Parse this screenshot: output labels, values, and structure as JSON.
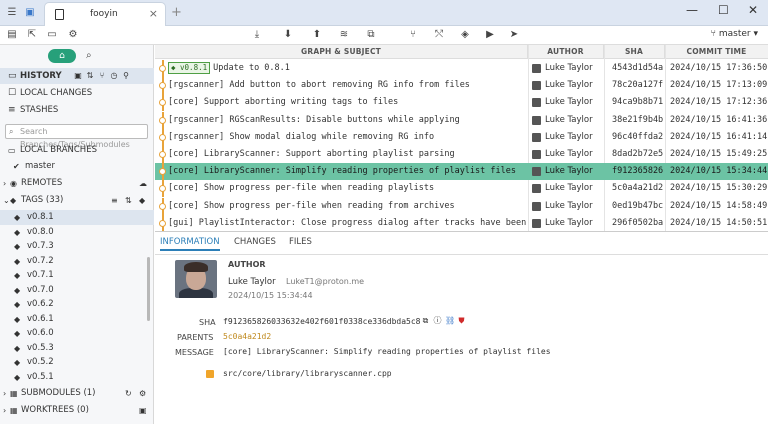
{
  "window": {
    "tab_title": "fooyin",
    "tab_close": "×",
    "new_tab": "+",
    "minimize": "—",
    "maximize": "☐",
    "close": "✕"
  },
  "toolbar": {
    "branch": "master"
  },
  "sidebar": {
    "history": "HISTORY",
    "local_changes": "LOCAL CHANGES",
    "stashes": "STASHES",
    "search_placeholder": "Search Branches/Tags/Submodules",
    "local_branches": "LOCAL BRANCHES",
    "branch_master": "master",
    "remotes": "REMOTES",
    "tags": "TAGS (33)",
    "tag_items": [
      "v0.8.1",
      "v0.8.0",
      "v0.7.3",
      "v0.7.2",
      "v0.7.1",
      "v0.7.0",
      "v0.6.2",
      "v0.6.1",
      "v0.6.0",
      "v0.5.3",
      "v0.5.2",
      "v0.5.1"
    ],
    "submodules": "SUBMODULES (1)",
    "worktrees": "WORKTREES (0)"
  },
  "table": {
    "headers": {
      "graph": "GRAPH & SUBJECT",
      "author": "AUTHOR",
      "sha": "SHA",
      "time": "COMMIT TIME"
    },
    "rows": [
      {
        "tag": "v0.8.1",
        "subject": "Update to 0.8.1",
        "author": "Luke Taylor",
        "sha": "4543d1d54a",
        "time": "2024/10/15 17:36:50"
      },
      {
        "subject": "[rgscanner] Add button to abort removing RG info from files",
        "author": "Luke Taylor",
        "sha": "78c20a127f",
        "time": "2024/10/15 17:13:09"
      },
      {
        "subject": "[core] Support aborting writing tags to files",
        "author": "Luke Taylor",
        "sha": "94ca9b8b71",
        "time": "2024/10/15 17:12:36"
      },
      {
        "subject": "[rgscanner] RGScanResults: Disable buttons while applying",
        "author": "Luke Taylor",
        "sha": "38e21f9b4b",
        "time": "2024/10/15 16:41:36"
      },
      {
        "subject": "[rgscanner] Show modal dialog while removing RG info",
        "author": "Luke Taylor",
        "sha": "96c40ffda2",
        "time": "2024/10/15 16:41:14"
      },
      {
        "subject": "[core] LibraryScanner: Support aborting playlist parsing",
        "author": "Luke Taylor",
        "sha": "8dad2b72e5",
        "time": "2024/10/15 15:49:25"
      },
      {
        "subject": "[core] LibraryScanner: Simplify reading properties of playlist files",
        "author": "Luke Taylor",
        "sha": "f912365826",
        "time": "2024/10/15 15:34:44"
      },
      {
        "subject": "[core] Show progress per-file when reading playlists",
        "author": "Luke Taylor",
        "sha": "5c0a4a21d2",
        "time": "2024/10/15 15:30:29"
      },
      {
        "subject": "[core] Show progress per-file when reading from archives",
        "author": "Luke Taylor",
        "sha": "0ed19b47bc",
        "time": "2024/10/15 14:58:49"
      },
      {
        "subject": "[gui] PlaylistInteractor: Close progress dialog after tracks have been added",
        "author": "Luke Taylor",
        "sha": "296f0502ba",
        "time": "2024/10/15 14:50:51"
      }
    ]
  },
  "details": {
    "tabs": [
      "INFORMATION",
      "CHANGES",
      "FILES"
    ],
    "author_label": "AUTHOR",
    "author_name": "Luke Taylor",
    "author_email": "LukeT1@proton.me",
    "author_time": "2024/10/15 15:34:44",
    "sha_label": "SHA",
    "sha_value": "f912365826033632e402f601f0338ce336dbda5c8",
    "parents_label": "PARENTS",
    "parents_value": "5c0a4a21d2",
    "message_label": "MESSAGE",
    "message_value": "[core] LibraryScanner: Simplify reading properties of playlist files",
    "file": "src/core/library/libraryscanner.cpp"
  },
  "colors": {
    "accent": "#27a07a",
    "selected_row": "#6cc3a4",
    "graph": "#e8a33a",
    "tab_active": "#2c7fb8"
  }
}
